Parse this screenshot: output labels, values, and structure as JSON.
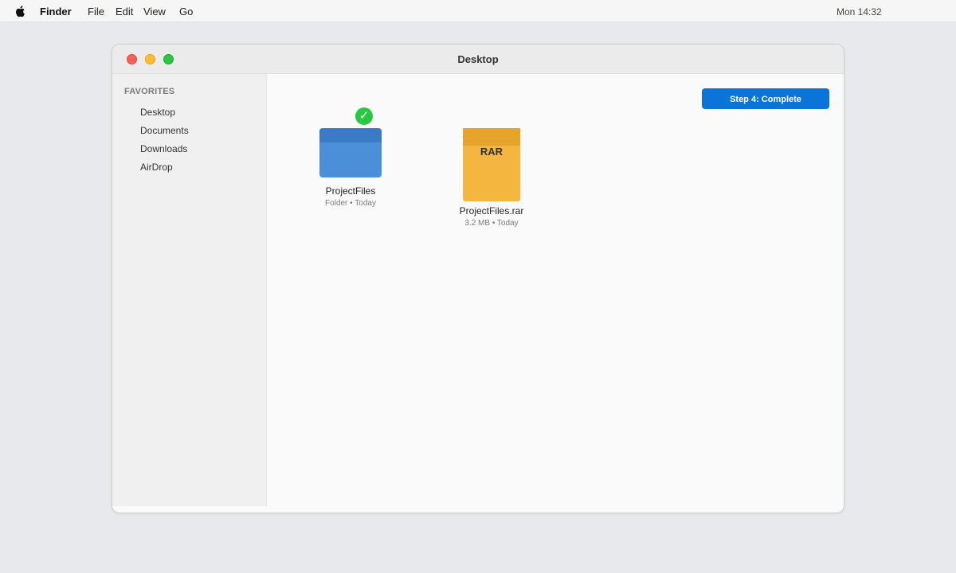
{
  "menubar": {
    "apple_icon": "apple-icon",
    "app_name": "Finder",
    "items": [
      "File",
      "Edit",
      "View",
      "Go"
    ],
    "clock": "Mon 14:32"
  },
  "window": {
    "title": "Desktop",
    "traffic_colors": {
      "close": "#ff5f57",
      "minimize": "#febc2e",
      "zoom": "#28c840"
    }
  },
  "sidebar": {
    "heading": "FAVORITES",
    "items": [
      {
        "label": "Desktop"
      },
      {
        "label": "Documents"
      },
      {
        "label": "Downloads"
      },
      {
        "label": "AirDrop"
      }
    ]
  },
  "content": {
    "step_button_label": "Step 4: Complete",
    "files": [
      {
        "name": "ProjectFiles",
        "meta": "Folder • Today",
        "icon": "folder-icon",
        "badge": "✓",
        "badge_icon": "checkmark-icon"
      },
      {
        "name": "ProjectFiles.rar",
        "meta": "3.2 MB • Today",
        "icon": "rar-archive-icon",
        "icon_text": "RAR"
      }
    ]
  },
  "colors": {
    "accent": "#0a74d8",
    "folder": "#4a90d9",
    "archive": "#f5b63f",
    "success": "#28c840"
  }
}
